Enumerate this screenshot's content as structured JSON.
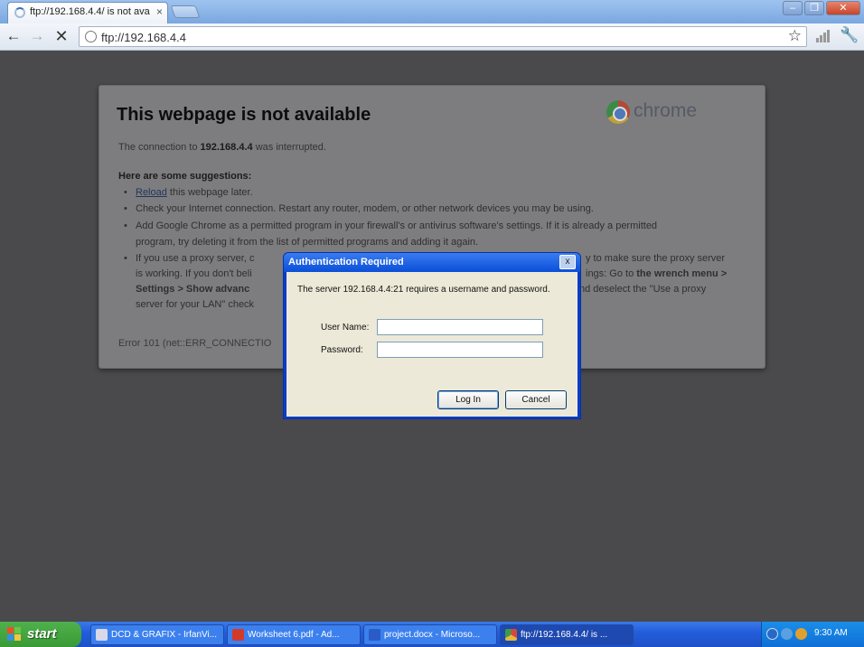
{
  "browser": {
    "tab_title": "ftp://192.168.4.4/ is not ava",
    "url": "ftp://192.168.4.4",
    "window_buttons": {
      "minimize": "–",
      "maximize": "❐",
      "close": "✕"
    }
  },
  "error_page": {
    "title": "This webpage is not available",
    "brand": "chrome",
    "connection_prefix": "The connection to ",
    "connection_host": "192.168.4.4",
    "connection_suffix": " was interrupted.",
    "suggestions_heading": "Here are some suggestions:",
    "suggestions": {
      "reload_link": "Reload",
      "reload_rest": " this webpage later.",
      "check": "Check your Internet connection. Restart any router, modem, or other network devices you may be using.",
      "firewall_1": "Add Google Chrome as a permitted program in your firewall's or antivirus software's settings. If it is already a permitted",
      "firewall_2": "program, try deleting it from the list of permitted programs and adding it again.",
      "proxy_1_left": "If you use a proxy server, c",
      "proxy_1_right": "y to make sure the proxy server",
      "proxy_2_left": "is working. If you don't beli",
      "proxy_2_right": "ings: Go to ",
      "proxy_2_bold": "the wrench menu >",
      "proxy_3_left_bold": "Settings > Show advanc",
      "proxy_3_right": "nd deselect the \"Use a proxy",
      "proxy_4_left": "server for your LAN\" check"
    },
    "error_code": "Error 101 (net::ERR_CONNECTIO"
  },
  "dialog": {
    "title": "Authentication Required",
    "close_glyph": "x",
    "message": "The server 192.168.4.4:21 requires a username and password.",
    "username_label": "User Name:",
    "password_label": "Password:",
    "username_value": "",
    "password_value": "",
    "login_label": "Log In",
    "cancel_label": "Cancel"
  },
  "taskbar": {
    "start_label": "start",
    "tasks": [
      {
        "label": "DCD & GRAFIX - IrfanVi..."
      },
      {
        "label": "Worksheet 6.pdf - Ad..."
      },
      {
        "label": "project.docx - Microso..."
      },
      {
        "label": "ftp://192.168.4.4/ is ..."
      }
    ],
    "clock": "9:30 AM"
  },
  "colors": {
    "accent": "#245edb",
    "dialog_title": "#0a4ed8",
    "page_overlay": "#4a4a4c"
  }
}
